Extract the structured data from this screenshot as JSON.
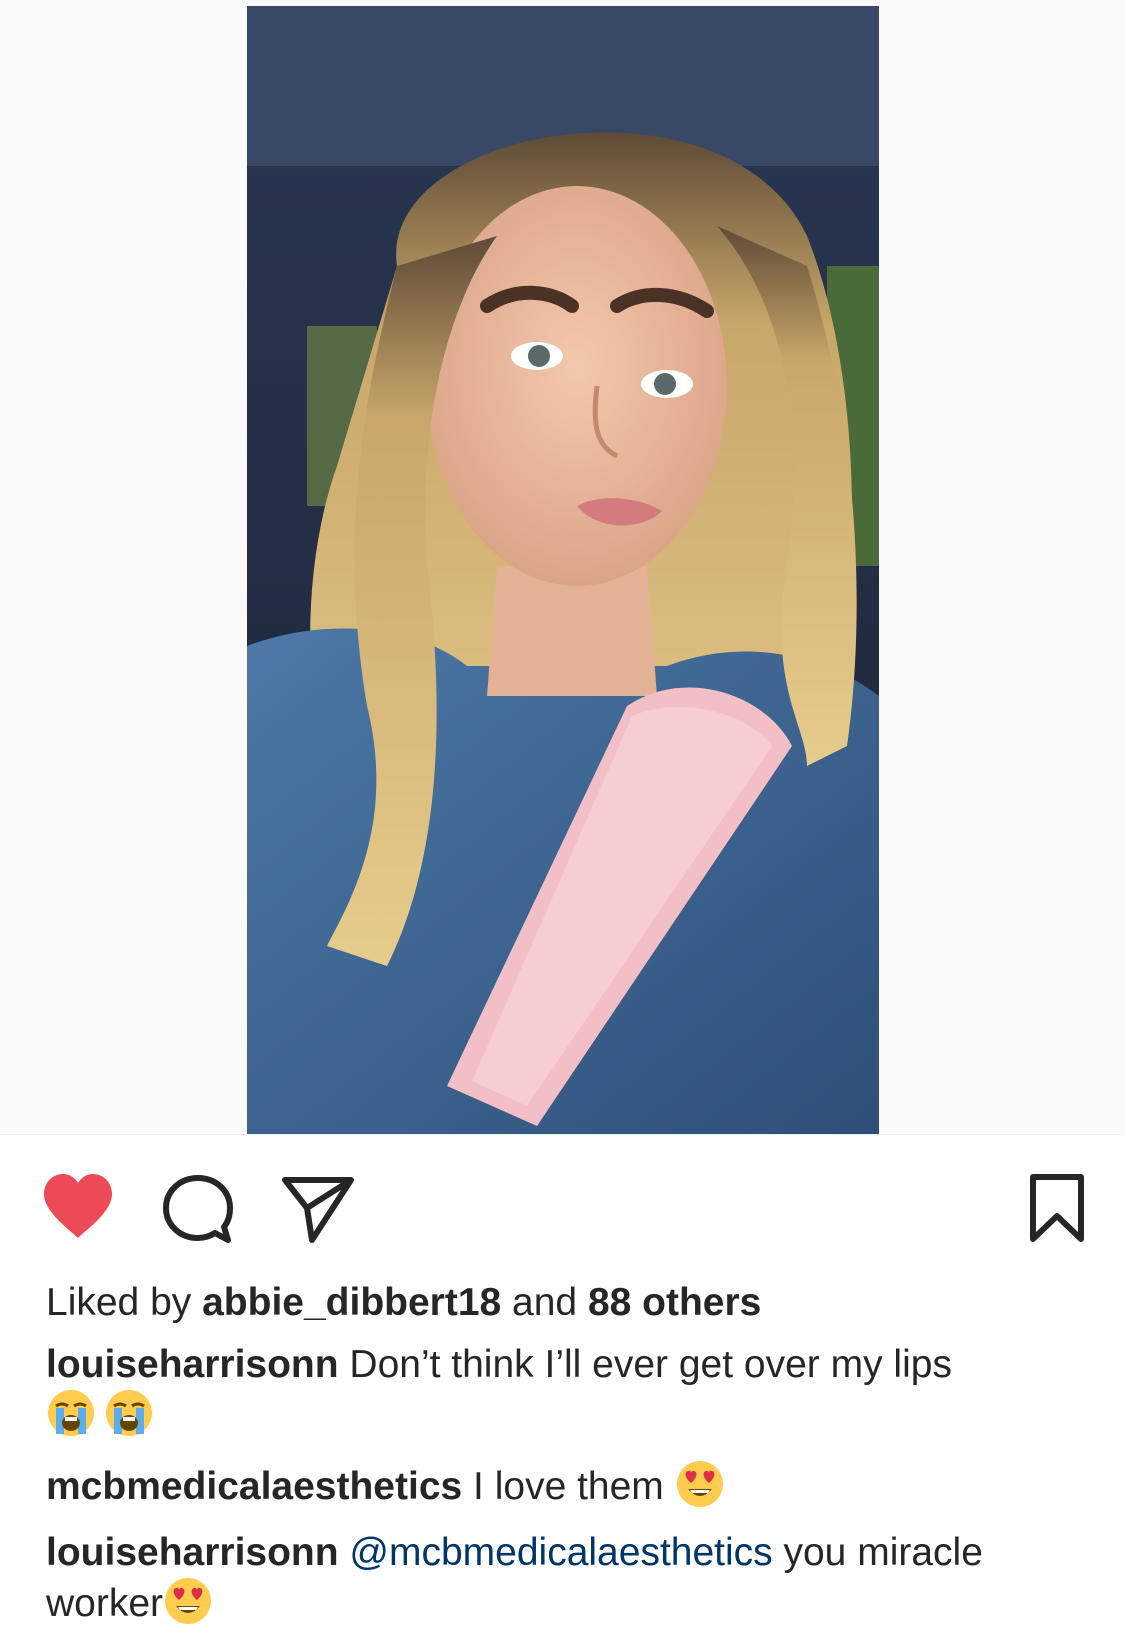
{
  "post": {
    "photo_alt": "Selfie of a woman with long wavy blonde hair wearing a denim jacket and a pink fluffy seatbelt cover, taken in a car"
  },
  "actions": {
    "like_icon": "heart-filled-icon",
    "comment_icon": "comment-bubble-icon",
    "share_icon": "paper-plane-icon",
    "save_icon": "bookmark-icon",
    "like_color": "#ed4956",
    "liked": true
  },
  "likes": {
    "prefix": "Liked by ",
    "user": "abbie_dibbert18",
    "joiner": " and ",
    "others": "88 others"
  },
  "comments": [
    {
      "username": "louiseharrisonn",
      "text": " Don’t think I’ll ever get over my lips ",
      "emojis": [
        "loudly-crying-face",
        "loudly-crying-face"
      ]
    },
    {
      "username": "mcbmedicalaesthetics",
      "text": " I love them ",
      "emojis": [
        "heart-eyes-face"
      ]
    },
    {
      "username": "louiseharrisonn",
      "mention": "@mcbmedicalaesthetics",
      "text": " you miracle worker",
      "emojis": [
        "heart-eyes-face"
      ]
    }
  ],
  "colors": {
    "text": "#262626",
    "mention": "#003569",
    "background": "#ffffff",
    "media_background": "#fafafa"
  }
}
